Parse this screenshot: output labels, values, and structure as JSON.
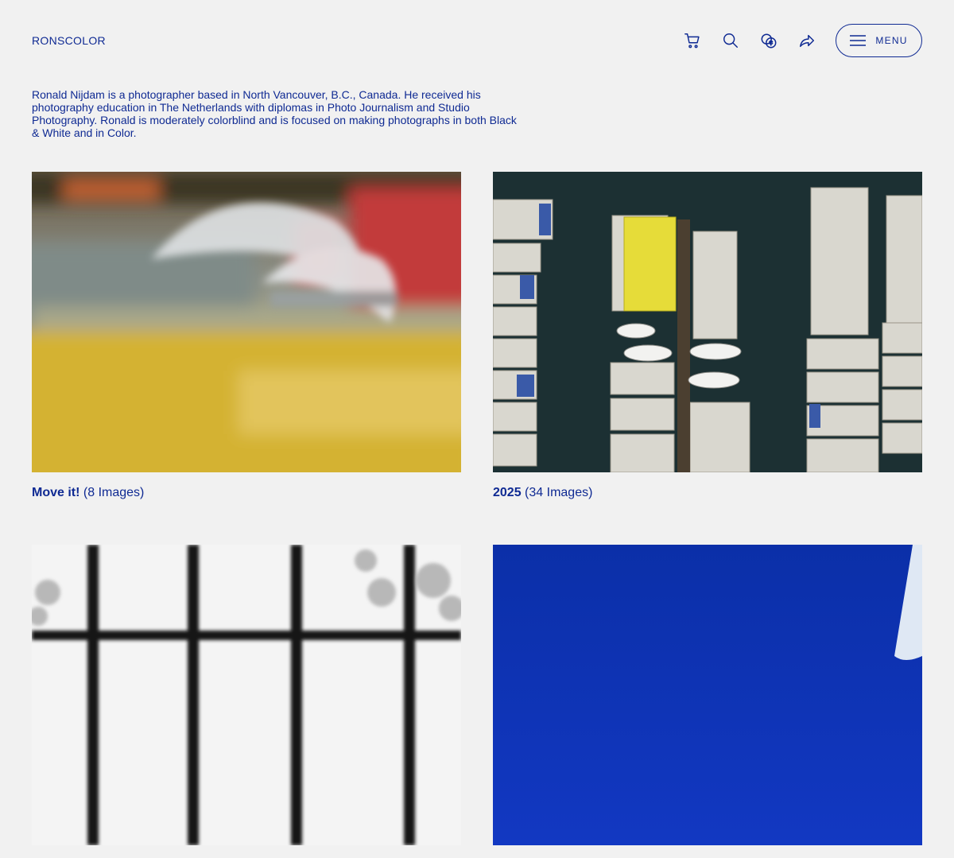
{
  "header": {
    "logo": "RONSCOLOR",
    "menu_label": "MENU",
    "icons": [
      "cart-icon",
      "search-icon",
      "currency-icon",
      "share-icon",
      "hamburger-icon"
    ]
  },
  "intro": {
    "text": "Ronald Nijdam is a photographer based in North Vancouver, B.C., Canada. He received his photography education in The Netherlands with diplomas in Photo Journalism and Studio Photography. Ronald is moderately colorblind and is focused on making photographs in both Black & White and in Color."
  },
  "galleries": [
    {
      "title": "Move it!",
      "count": "(8 Images)"
    },
    {
      "title": "2025",
      "count": "(34 Images)"
    },
    {
      "title": "",
      "count": ""
    },
    {
      "title": "",
      "count": ""
    }
  ],
  "colors": {
    "accent": "#0f2a93",
    "background": "#f1f1f1"
  }
}
